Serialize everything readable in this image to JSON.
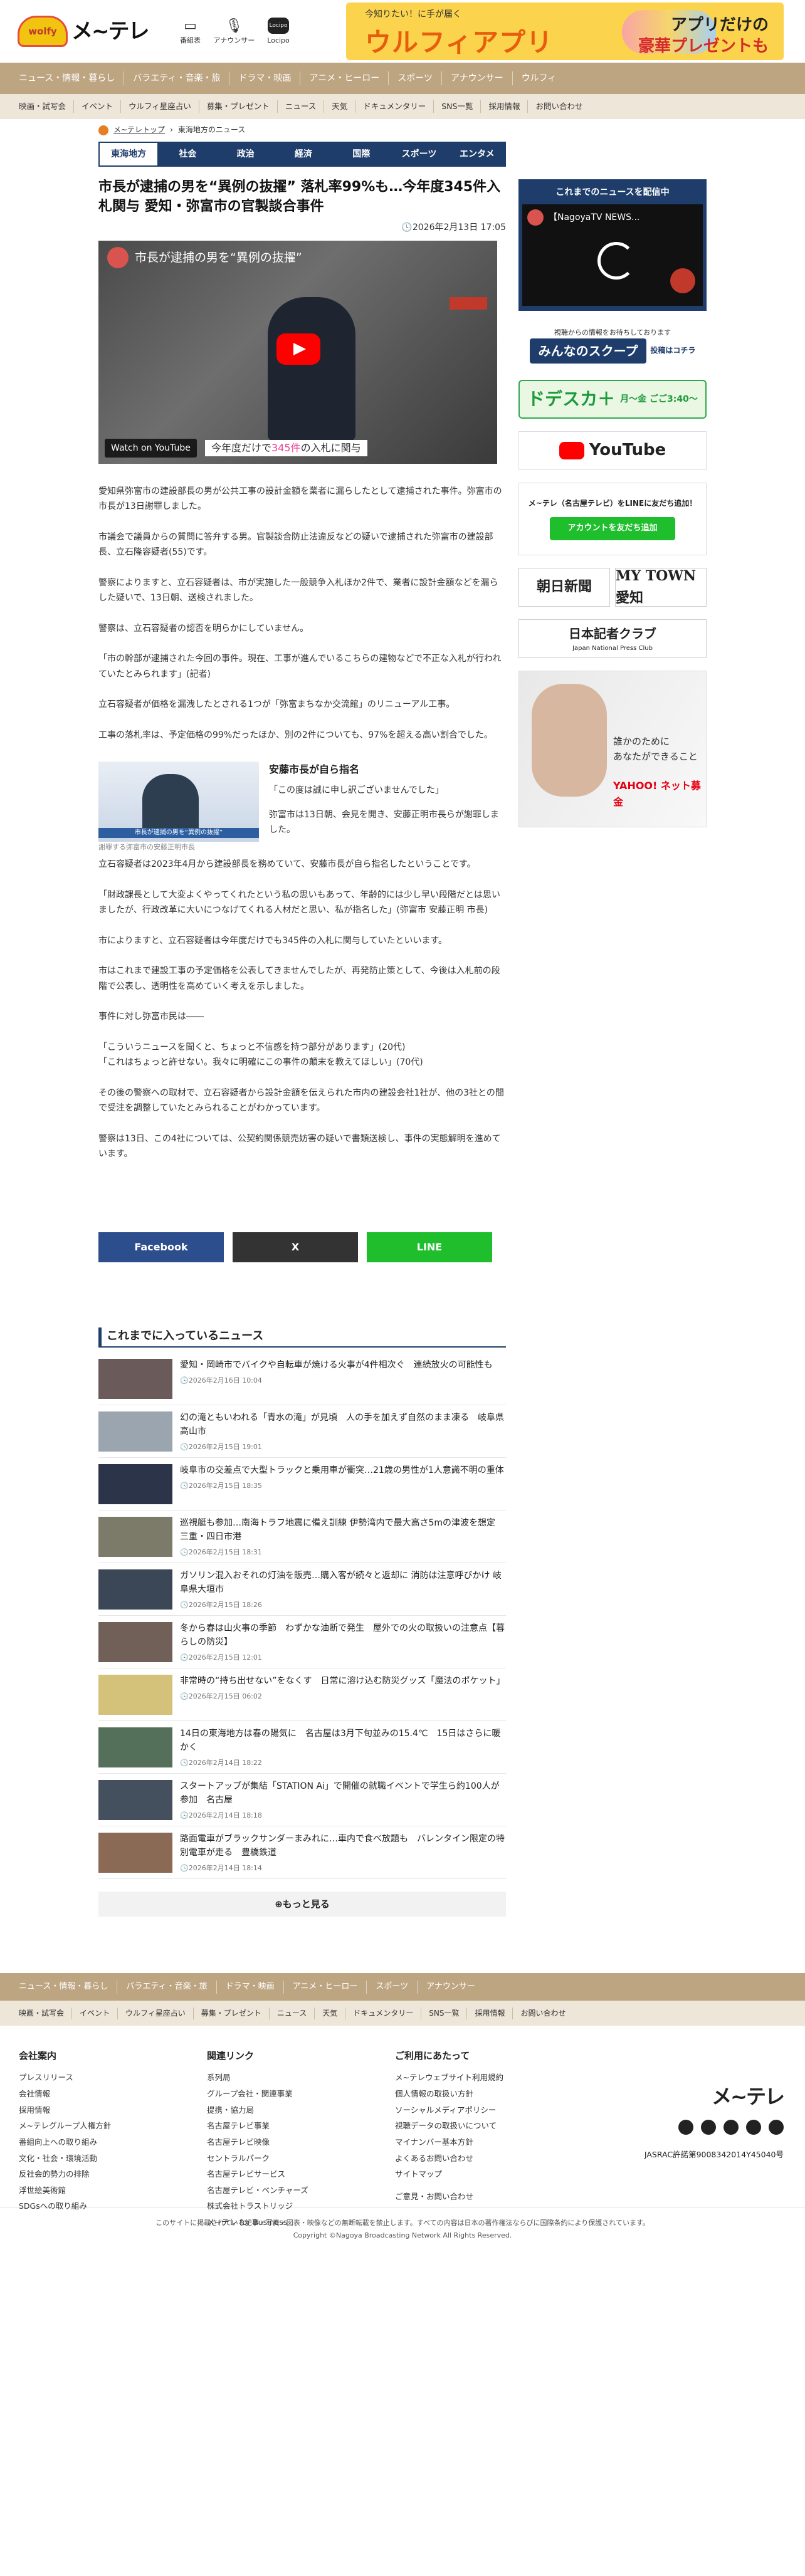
{
  "header": {
    "brand": "メ~テレ",
    "icons": [
      {
        "label": "番組表",
        "icon": "tv-icon"
      },
      {
        "label": "アナウンサー",
        "icon": "microphone-icon"
      },
      {
        "label": "Locipo",
        "icon": "locipo-icon"
      }
    ],
    "banner": {
      "line1": "今知りたい！に手が届く",
      "line2": "ウルフィアプリ",
      "right1": "アプリだけの",
      "right2": "豪華プレゼントも"
    }
  },
  "nav_main": [
    "ニュース・情報・暮らし",
    "バラエティ・音楽・旅",
    "ドラマ・映画",
    "アニメ・ヒーロー",
    "スポーツ",
    "アナウンサー",
    "ウルフィ"
  ],
  "nav_sub": [
    "映画・試写会",
    "イベント",
    "ウルフィ星座占い",
    "募集・プレゼント",
    "ニュース",
    "天気",
    "ドキュメンタリー",
    "SNS一覧",
    "採用情報",
    "お問い合わせ"
  ],
  "breadcrumb": {
    "home": "メ~テレトップ",
    "current": "東海地方のニュース"
  },
  "tabs": [
    "東海地方",
    "社会",
    "政治",
    "経済",
    "国際",
    "スポーツ",
    "エンタメ"
  ],
  "article": {
    "title": "市長が逮捕の男を“異例の抜擢” 落札率99%も…今年度345件入札関与 愛知・弥富市の官製談合事件",
    "date": "2026年2月13日 17:05",
    "video": {
      "title": "市長が逮捕の男を“異例の抜擢”",
      "watch": "Watch on YouTube",
      "caption_pre": "今年度だけで",
      "caption_num": "345件",
      "caption_post": "の入札に関与"
    },
    "paragraphs": [
      "愛知県弥富市の建設部長の男が公共工事の設計金額を業者に漏らしたとして逮捕された事件。弥富市の市長が13日謝罪しました。",
      "市議会で議員からの質問に答弁する男。官製談合防止法違反などの疑いで逮捕された弥富市の建設部長、立石隆容疑者(55)です。",
      "警察によりますと、立石容疑者は、市が実施した一般競争入札ほか2件で、業者に設計金額などを漏らした疑いで、13日朝、送検されました。",
      "警察は、立石容疑者の認否を明らかにしていません。",
      "「市の幹部が逮捕された今回の事件。現在、工事が進んでいるこちらの建物などで不正な入札が行われていたとみられます」(記者)",
      "立石容疑者が価格を漏洩したとされる1つが「弥富まちなか交流館」のリニューアル工事。",
      "工事の落札率は、予定価格の99%だったほか、別の2件についても、97%を超える高い割合でした。"
    ],
    "section": {
      "heading": "安藤市長が自ら指名",
      "image_caption": "謝罪する弥富市の安藤正明市長",
      "image_ticker": "市長が逮捕の男を“異例の抜擢”",
      "paragraphs": [
        "「この度は誠に申し訳ございませんでした」",
        "弥富市は13日朝、会見を開き、安藤正明市長らが謝罪しました。"
      ]
    },
    "paragraphs2": [
      "立石容疑者は2023年4月から建設部長を務めていて、安藤市長が自ら指名したということです。",
      "「財政課長として大変よくやってくれたという私の思いもあって、年齢的には少し早い段階だとは思いましたが、行政改革に大いにつなげてくれる人材だと思い、私が指名した」(弥富市 安藤正明 市長)",
      "市によりますと、立石容疑者は今年度だけでも345件の入札に関与していたといいます。",
      "市はこれまで建設工事の予定価格を公表してきませんでしたが、再発防止策として、今後は入札前の段階で公表し、透明性を高めていく考えを示しました。",
      "事件に対し弥富市民は――",
      "「こういうニュースを聞くと、ちょっと不信感を持つ部分があります」(20代)\n「これはちょっと許せない。我々に明確にこの事件の顛末を教えてほしい」(70代)",
      "その後の警察への取材で、立石容疑者から設計金額を伝えられた市内の建設会社1社が、他の3社との間で受注を調整していたとみられることがわかっています。",
      "警察は13日、この4社については、公契約関係競売妨害の疑いで書類送検し、事件の実態解明を進めています。"
    ]
  },
  "share": {
    "facebook": "Facebook",
    "x": "X",
    "line": "LINE"
  },
  "news_heading": "これまでに入っているニュース",
  "news": [
    {
      "title": "愛知・岡崎市でバイクや自転車が焼ける火事が4件相次ぐ　連続放火の可能性も",
      "time": "2026年2月16日 10:04",
      "color": "#6b5a5a"
    },
    {
      "title": "幻の滝ともいわれる「青水の滝」が見頃　人の手を加えず自然のまま凍る　岐阜県高山市",
      "time": "2026年2月15日 19:01",
      "color": "#9aa5b0"
    },
    {
      "title": "岐阜市の交差点で大型トラックと乗用車が衝突…21歳の男性が1人意識不明の重体",
      "time": "2026年2月15日 18:35",
      "color": "#2b3448"
    },
    {
      "title": "巡視艇も参加…南海トラフ地震に備え訓練 伊勢湾内で最大高さ5mの津波を想定 三重・四日市港",
      "time": "2026年2月15日 18:31",
      "color": "#7c7a68"
    },
    {
      "title": "ガソリン混入おそれの灯油を販売…購入客が続々と返却に 消防は注意呼びかけ 岐阜県大垣市",
      "time": "2026年2月15日 18:26",
      "color": "#3b4656"
    },
    {
      "title": "冬から春は山火事の季節　わずかな油断で発生　屋外での火の取扱いの注意点【暮らしの防災】",
      "time": "2026年2月15日 12:01",
      "color": "#706058"
    },
    {
      "title": "非常時の“持ち出せない”をなくす　日常に溶け込む防災グッズ「魔法のポケット」",
      "time": "2026年2月15日 06:02",
      "color": "#d5c27a"
    },
    {
      "title": "14日の東海地方は春の陽気に　名古屋は3月下旬並みの15.4℃　15日はさらに暖かく",
      "time": "2026年2月14日 18:22",
      "color": "#55705a"
    },
    {
      "title": "スタートアップが集結「STATION Ai」で開催の就職イベントで学生ら約100人が参加　名古屋",
      "time": "2026年2月14日 18:18",
      "color": "#44505e"
    },
    {
      "title": "路面電車がブラックサンダーまみれに…車内で食べ放題も　バレンタイン限定の特別電車が走る　豊橋鉄道",
      "time": "2026年2月14日 18:14",
      "color": "#8a6a55"
    }
  ],
  "more": "もっと見る",
  "sidebar": {
    "video_label": "これまでのニュースを配信中",
    "video_title": "【NagoyaTV NEWS...",
    "scoop_top": "視聴からの情報をお待ちしております",
    "scoop_main": "みんなのスクープ",
    "scoop_side": "投稿はコチラ",
    "dosuka": "ドデスカ＋",
    "dosuka_time": "月〜金 ごご3:40〜",
    "youtube": "YouTube",
    "line_top": "メ~テレ（名古屋テレビ）をLINEに友だち追加！",
    "line_btn": "アカウントを友だち追加",
    "asahi": "朝日新聞",
    "mytown": "MY TOWN 愛知",
    "kisha": "日本記者クラブ",
    "kisha_en": "Japan National Press Club",
    "ad_text": "誰かのために\nあなたができること",
    "ad_brand": "YAHOO! ネット募金"
  },
  "footer": {
    "nav_main": [
      "ニュース・情報・暮らし",
      "バラエティ・音楽・旅",
      "ドラマ・映画",
      "アニメ・ヒーロー",
      "スポーツ",
      "アナウンサー"
    ],
    "nav_sub": [
      "映画・試写会",
      "イベント",
      "ウルフィ星座占い",
      "募集・プレゼント",
      "ニュース",
      "天気",
      "ドキュメンタリー",
      "SNS一覧",
      "採用情報",
      "お問い合わせ"
    ],
    "cols": [
      {
        "title": "会社案内",
        "items": [
          "プレスリリース",
          "会社情報",
          "採用情報",
          "メ~テレグループ人権方針",
          "番組向上への取り組み",
          "文化・社会・環境活動",
          "反社会的勢力の排除",
          "浮世絵美術館",
          "SDGsへの取り組み"
        ]
      },
      {
        "title": "関連リンク",
        "items": [
          "系列局",
          "グループ会社・関連事業",
          "提携・協力局",
          "名古屋テレビ事業",
          "名古屋テレビ映像",
          "セントラルパーク",
          "名古屋テレビサービス",
          "名古屋テレビ・ベンチャーズ",
          "株式会社トラストリッジ",
          "メ~テレ for Business"
        ]
      },
      {
        "title": "ご利用にあたって",
        "items": [
          "メ~テレウェブサイト利用規約",
          "個人情報の取扱い方針",
          "ソーシャルメディアポリシー",
          "視聴データの取扱いについて",
          "マイナンバー基本方針",
          "よくあるお問い合わせ",
          "サイトマップ"
        ],
        "extra": "ご意見・お問い合わせ"
      }
    ],
    "brand": "メ~テレ",
    "jasrac": "JASRAC許諾第9008342014Y45040号",
    "copy1": "このサイトに掲載されている記事・写真・図表・映像などの無断転載を禁止します。すべての内容は日本の著作権法ならびに国際条約により保護されています。",
    "copy2": "Copyright ©Nagoya Broadcasting Network All Rights Reserved."
  }
}
